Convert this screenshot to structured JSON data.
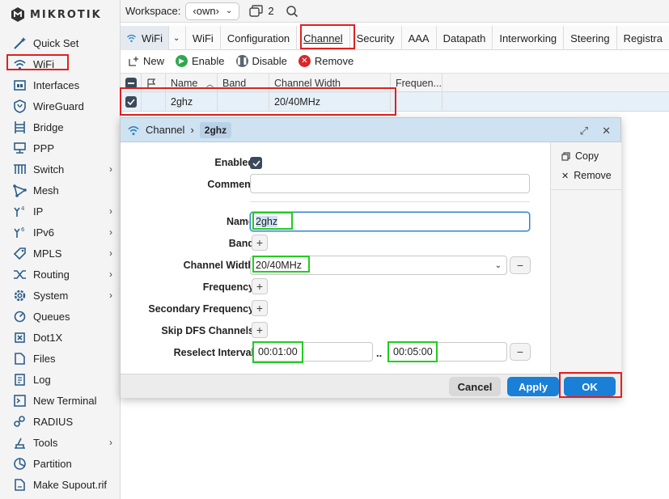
{
  "app": {
    "brand": "MikroTik"
  },
  "sidebar": {
    "items": [
      {
        "label": "Quick Set",
        "icon": "wand-icon",
        "chevron": false
      },
      {
        "label": "WiFi",
        "icon": "wifi-icon",
        "chevron": false
      },
      {
        "label": "Interfaces",
        "icon": "interfaces-icon",
        "chevron": false
      },
      {
        "label": "WireGuard",
        "icon": "wireguard-icon",
        "chevron": false
      },
      {
        "label": "Bridge",
        "icon": "bridge-icon",
        "chevron": false
      },
      {
        "label": "PPP",
        "icon": "ppp-icon",
        "chevron": false
      },
      {
        "label": "Switch",
        "icon": "switch-icon",
        "chevron": true
      },
      {
        "label": "Mesh",
        "icon": "mesh-icon",
        "chevron": false
      },
      {
        "label": "IP",
        "icon": "ip-icon",
        "chevron": true
      },
      {
        "label": "IPv6",
        "icon": "ipv6-icon",
        "chevron": true
      },
      {
        "label": "MPLS",
        "icon": "mpls-icon",
        "chevron": true
      },
      {
        "label": "Routing",
        "icon": "routing-icon",
        "chevron": true
      },
      {
        "label": "System",
        "icon": "gear-icon",
        "chevron": true
      },
      {
        "label": "Queues",
        "icon": "queues-icon",
        "chevron": false
      },
      {
        "label": "Dot1X",
        "icon": "dot1x-icon",
        "chevron": false
      },
      {
        "label": "Files",
        "icon": "files-icon",
        "chevron": false
      },
      {
        "label": "Log",
        "icon": "log-icon",
        "chevron": false
      },
      {
        "label": "New Terminal",
        "icon": "terminal-icon",
        "chevron": false
      },
      {
        "label": "RADIUS",
        "icon": "radius-icon",
        "chevron": false
      },
      {
        "label": "Tools",
        "icon": "tools-icon",
        "chevron": true
      },
      {
        "label": "Partition",
        "icon": "partition-icon",
        "chevron": false
      },
      {
        "label": "Make Supout.rif",
        "icon": "supout-icon",
        "chevron": false
      }
    ]
  },
  "topbar": {
    "workspace_label": "Workspace:",
    "workspace_value": "‹own›",
    "windows_count": "2"
  },
  "tabs": [
    {
      "label": "WiFi"
    },
    {
      "label": "Configuration"
    },
    {
      "label": "Channel"
    },
    {
      "label": "Security"
    },
    {
      "label": "AAA"
    },
    {
      "label": "Datapath"
    },
    {
      "label": "Interworking"
    },
    {
      "label": "Steering"
    },
    {
      "label": "Registra"
    }
  ],
  "tabs_menu_label": "WiFi",
  "toolbar": {
    "new": "New",
    "enable": "Enable",
    "disable": "Disable",
    "remove": "Remove"
  },
  "table": {
    "headers": [
      "Name",
      "Band",
      "Channel Width",
      "Frequen..."
    ],
    "rows": [
      {
        "name": "2ghz",
        "band": "",
        "width": "20/40MHz",
        "freq": ""
      }
    ]
  },
  "dialog": {
    "title": "Channel",
    "crumb": "2ghz",
    "fields": {
      "enabled": "Enabled",
      "comment": "Comment",
      "name": "Name",
      "name_value": "2ghz",
      "band": "Band",
      "channel_width": "Channel Width",
      "channel_width_value": "20/40MHz",
      "frequency": "Frequency",
      "secondary_frequency": "Secondary Frequency",
      "skip_dfs": "Skip DFS Channels",
      "reselect_interval": "Reselect Interval",
      "reselect_from": "00:01:00",
      "reselect_sep": "..",
      "reselect_to": "00:05:00"
    },
    "side": {
      "copy": "Copy",
      "remove": "Remove"
    },
    "buttons": {
      "cancel": "Cancel",
      "apply": "Apply",
      "ok": "OK"
    }
  },
  "colors": {
    "accent": "#1a7fd6",
    "highlight_red": "#e02020",
    "highlight_green": "#22cc22",
    "row_selected": "#e6f0f8"
  }
}
